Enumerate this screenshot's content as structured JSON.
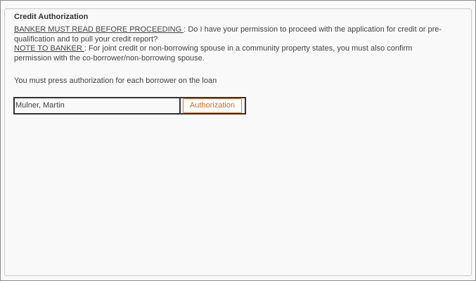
{
  "section": {
    "legend": "Credit Authorization"
  },
  "notice": {
    "banker_heading": "BANKER MUST READ BEFORE PROCEEDING ",
    "banker_text": ": Do I have your permission to proceed with the application for credit or pre-qualification and to pull your credit report?",
    "note_heading": "NOTE TO BANKER ",
    "note_text": ": For joint credit or non-borrowing spouse in a community property states, you must also confirm permission with the co-borrower/non-borrowing spouse."
  },
  "instruction": "You must press authorization for each borrower on the loan",
  "borrowers": [
    {
      "name": "Mulner, Martin",
      "button_label": "Authorization"
    }
  ],
  "colors": {
    "accent": "#d9691e",
    "border": "#333333"
  }
}
